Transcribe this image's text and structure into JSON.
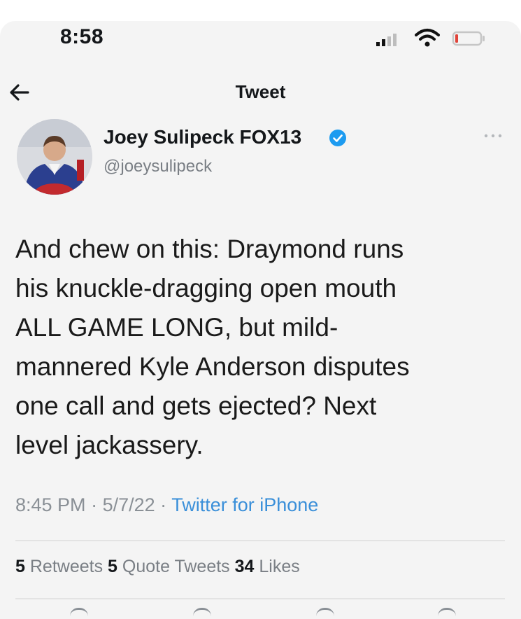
{
  "status_bar": {
    "time": "8:58"
  },
  "nav": {
    "title": "Tweet"
  },
  "author": {
    "name": "Joey Sulipeck FOX13",
    "handle": "@joeysulipeck",
    "verified": true
  },
  "tweet": {
    "lines": [
      "And chew on this:  Draymond runs",
      "his knuckle-dragging open mouth",
      "ALL GAME LONG, but mild-",
      "mannered Kyle Anderson disputes",
      "one call and gets ejected?  Next",
      "level jackassery."
    ],
    "time": "8:45 PM",
    "date": "5/7/22",
    "source": "Twitter for iPhone"
  },
  "stats": {
    "retweets_count": "5",
    "retweets_label": "Retweets",
    "quotes_count": "5",
    "quotes_label": "Quote Tweets",
    "likes_count": "34",
    "likes_label": "Likes"
  },
  "colors": {
    "accent": "#3a8fd9",
    "verified_badge": "#1d9bf0",
    "battery_low": "#e0443a"
  },
  "icons": {
    "back": "arrow-left-icon",
    "verified": "verified-badge-icon",
    "more": "more-dots-icon",
    "signal": "cellular-signal-icon",
    "wifi": "wifi-icon",
    "battery": "battery-icon"
  }
}
